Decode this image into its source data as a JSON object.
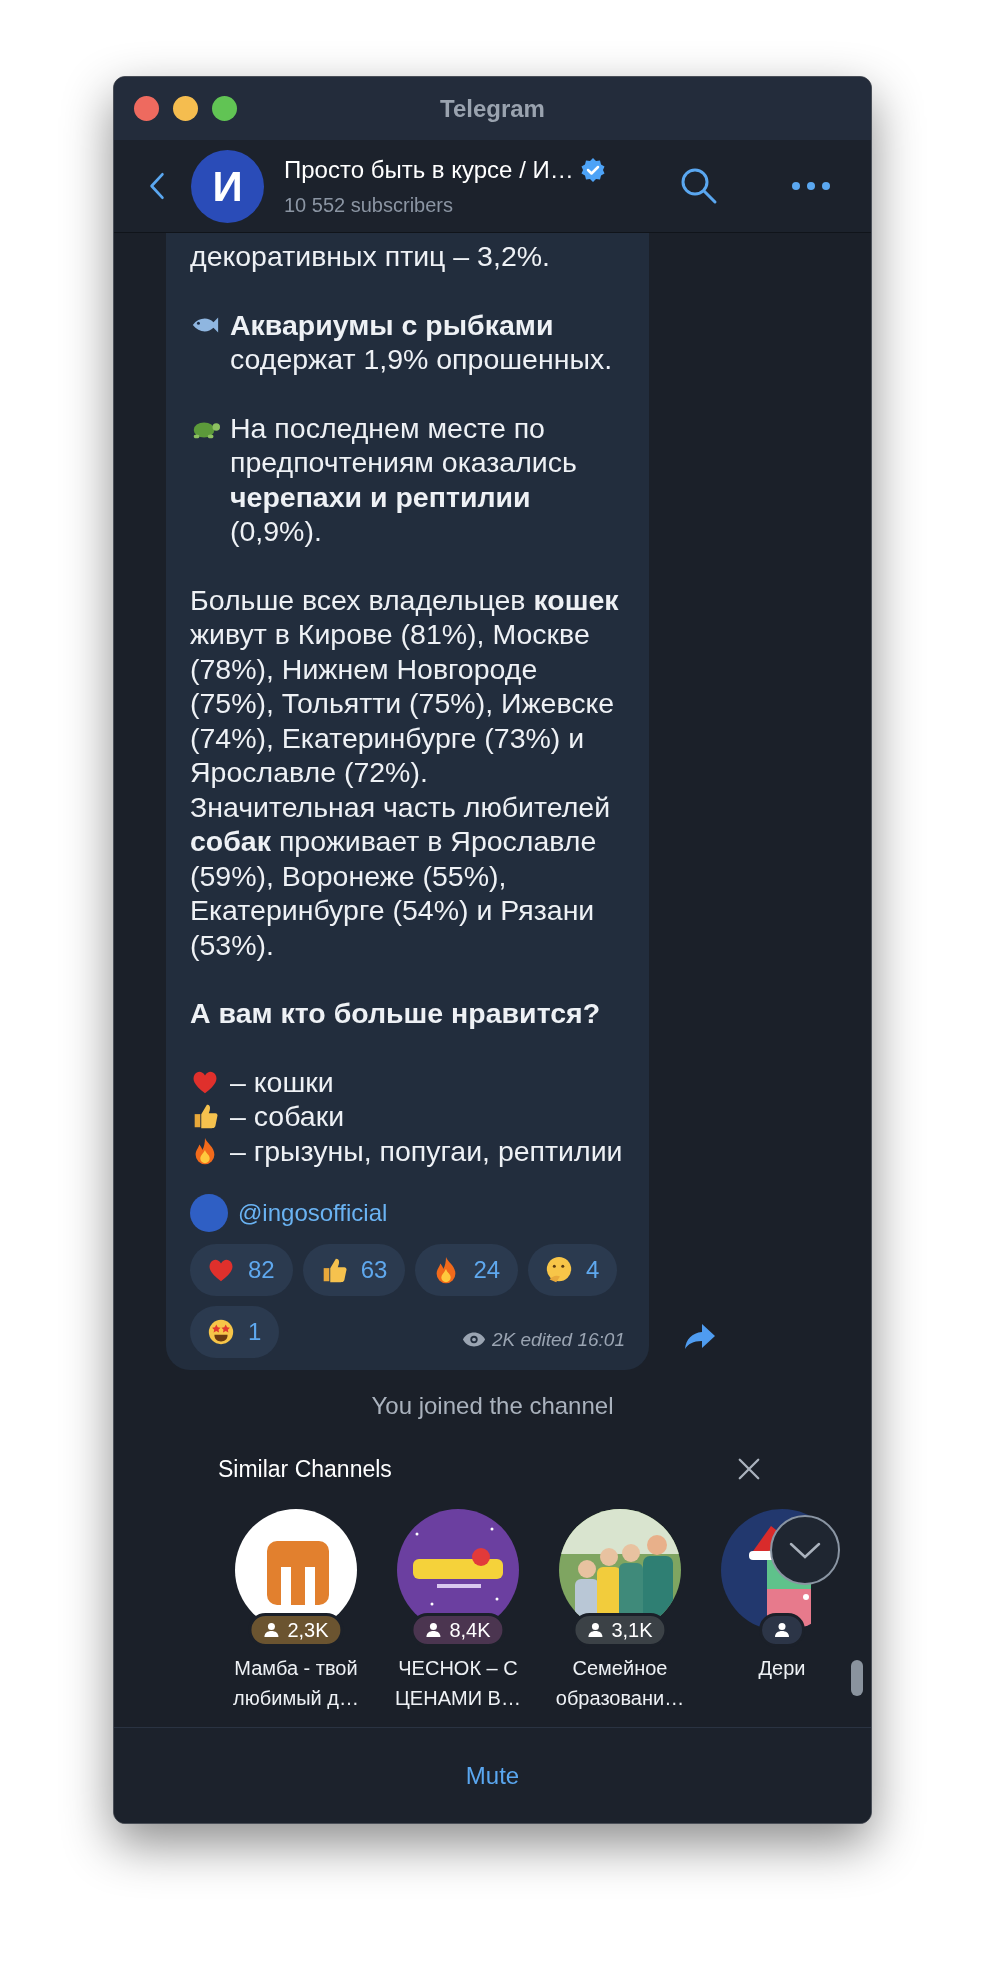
{
  "window": {
    "title": "Telegram"
  },
  "header": {
    "avatar_letter": "И",
    "channel_title": "Просто быть в курсе / И…",
    "verified": true,
    "subscribers": "10 552 subscribers"
  },
  "message": {
    "blocks": [
      {
        "lines": [
          {
            "text": "декоративных птиц – 3,2%."
          }
        ]
      },
      {
        "lines": [
          {
            "kind": "fish",
            "text": "**Аквариумы с рыбками** содержат 1,9% опрошенных."
          }
        ]
      },
      {
        "lines": [
          {
            "kind": "turtle",
            "text": "На последнем месте по предпочтениям оказались **черепахи и рептилии** (0,9%)."
          }
        ]
      },
      {
        "lines": [
          {
            "text": "Больше всех владельцев **кошек** живут в Кирове (81%), Москве (78%), Нижнем Новгороде (75%), Тольятти (75%), Ижевске (74%), Екатеринбурге (73%) и Ярославле (72%)."
          },
          {
            "text": "Значительная часть любителей **собак** проживает в Ярославле (59%), Воронеже (55%), Екатеринбурге (54%) и Рязани (53%)."
          }
        ]
      },
      {
        "bold": true,
        "lines": [
          {
            "text": "А вам кто больше нравится?"
          }
        ]
      },
      {
        "lines": [
          {
            "kind": "heart",
            "text": "– кошки"
          },
          {
            "kind": "thumbs",
            "text": "– собаки"
          },
          {
            "kind": "fire",
            "text": "– грызуны, попугаи, рептилии"
          }
        ]
      }
    ],
    "signature": "@ingosofficial",
    "reactions": [
      {
        "kind": "heart",
        "count": "82"
      },
      {
        "kind": "thumbs",
        "count": "63"
      },
      {
        "kind": "fire",
        "count": "24"
      },
      {
        "kind": "thinking",
        "count": "4"
      },
      {
        "kind": "starstruck",
        "count": "1"
      }
    ],
    "meta": "2K edited 16:01"
  },
  "service_message": "You joined the channel",
  "similar_channels": {
    "title": "Similar Channels",
    "channels": [
      {
        "name": "Мамба - твой любимый д…",
        "subscribers": "2,3K",
        "color": "#6b5430"
      },
      {
        "name": "ЧЕСНОК – С ЦЕНАМИ В…",
        "subscribers": "8,4K",
        "color": "#4b3550"
      },
      {
        "name": "Семейное образовани…",
        "subscribers": "3,1K",
        "color": "#3b4146"
      },
      {
        "name": "Дери",
        "color": "#2c3547"
      }
    ]
  },
  "bottom_bar": {
    "button": "Mute"
  }
}
